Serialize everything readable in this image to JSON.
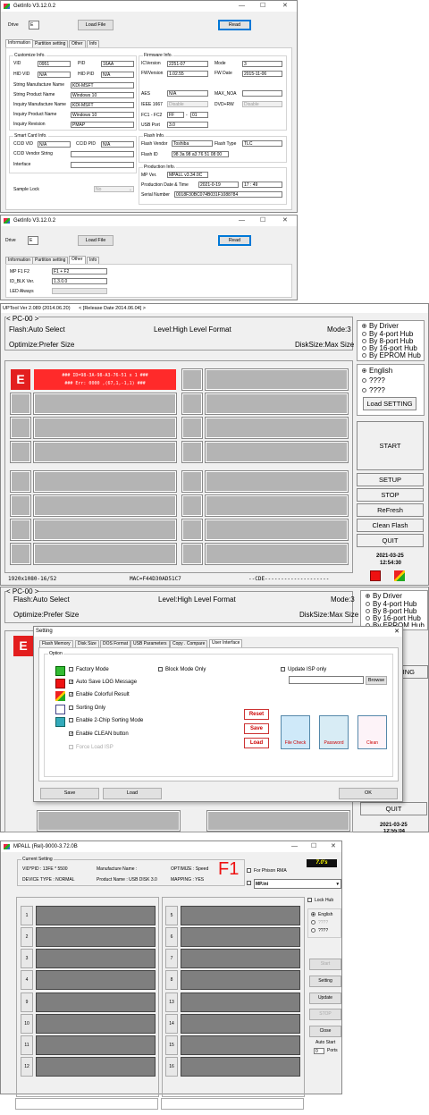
{
  "getinfo1": {
    "title": "GetInfo V3.12.0.2",
    "drive_label": "Drive",
    "drive_value": "E",
    "load_file": "Load File",
    "read": "Read",
    "tabs": [
      "Information",
      "Partition setting",
      "Other",
      "Info"
    ],
    "customize": {
      "legend": "Customize Info.",
      "vid_label": "VID",
      "vid": "0951",
      "pid_label": "PID",
      "pid": "16AA",
      "hid_vid_label": "HID VID",
      "hid_vid": "N/A",
      "hid_pid_label": "HID PID",
      "hid_pid": "N/A",
      "str_mfr_label": "String Manufacture Name",
      "str_mfr": "KDI-MSFT",
      "str_prod_label": "String Product Name",
      "str_prod": "Windows 10",
      "inq_mfr_label": "Inquiry Manufacture Name",
      "inq_mfr": "KDI-MSFT",
      "inq_prod_label": "Inquiry Product Name",
      "inq_prod": "Windows 10",
      "inq_rev_label": "Inquiry Revision",
      "inq_rev": "PMAP"
    },
    "smartcard": {
      "legend": "Smart Card Info.",
      "ccid_vid_label": "CCID VID",
      "ccid_vid": "N/A",
      "ccid_pid_label": "CCID PID",
      "ccid_pid": "N/A",
      "ccid_vendor_label": "CCID Vendor String",
      "interface_label": "Interface"
    },
    "sample_lock_label": "Sample Lock",
    "sample_lock_value": "No",
    "firmware": {
      "legend": "Firmware Info.",
      "icversion_label": "ICVersion",
      "icversion": "2251-07",
      "mode_label": "Mode",
      "mode": "3",
      "fwversion_label": "FWVersion",
      "fwversion": "1.02.55",
      "fwdate_label": "FW Date",
      "fwdate": "2015-11-06",
      "aes_label": "AES",
      "aes": "N/A",
      "maxnoa_label": "MAX_NOA",
      "ieee_label": "IEEE 1667",
      "ieee": "Disable",
      "dvdrw_label": "DVD+RW",
      "dvdrw": "Disable",
      "fc_label": "FC1 - FC2",
      "fc1": "FF",
      "fc_dash": "-",
      "fc2": "01",
      "usbport_label": "USB Port",
      "usbport": "3.0"
    },
    "flash": {
      "legend": "Flash Info.",
      "vendor_label": "Flash Vendor",
      "vendor": "Toshiba",
      "type_label": "Flash Type",
      "type": "TLC",
      "id_label": "Flash ID",
      "id": "98 3a 98 a3 76 51 08 00"
    },
    "production": {
      "legend": "Production Info.",
      "mpver_label": "MP Ver.",
      "mpver": "MPALL v3.34.0C",
      "date_label": "Production Date & Time",
      "date": "2021-0-19",
      "time": "17 : 49",
      "serial_label": "Serial Number",
      "serial": "0018F30BC074B031F1088784"
    }
  },
  "getinfo2": {
    "title": "GetInfo V3.12.0.2",
    "drive_label": "Drive",
    "drive_value": "E",
    "load_file": "Load File",
    "read": "Read",
    "tabs": [
      "Information",
      "Partition setting",
      "Other",
      "Info"
    ],
    "mp_f1f2_label": "MP F1 F2",
    "mp_f1f2": "F1 + F2",
    "id_blk_label": "ID_BLK Ver.",
    "id_blk": "1.3.0.0",
    "led_label": "LED Always"
  },
  "uptool1": {
    "title": "UPTool Ver 2.089 (2014.06.20)",
    "release": "< [Release Date 2014.06.04] >",
    "pc": "< PC-00 >",
    "flash_sel": "Flash:Auto Select",
    "level": "Level:High Level Format",
    "mode": "Mode:3",
    "optimize": "Optimize:Prefer Size",
    "disksize": "DiskSize:Max Size",
    "hub_options": [
      "By Driver",
      "By 4-port Hub",
      "By 8-port Hub",
      "By 16-port Hub",
      "By EPROM Hub"
    ],
    "lang_options": [
      "English",
      "????",
      "????"
    ],
    "load_setting": "Load SETTING",
    "start": "START",
    "setup": "SETUP",
    "stop": "STOP",
    "refresh": "ReFresh",
    "clean_flash": "Clean Flash",
    "quit": "QUIT",
    "slot_letter": "E",
    "slot_line1": "### ID=98-3A-98-A3-76-51 x 1 ###",
    "slot_line2": "### Err: 0000 ,(67,1,-1,1) ###",
    "resolution": "1920x1080-16/52",
    "mac": "MAC=F44D30AD51C7",
    "cde": "--CDE--------------------",
    "date": "2021-03-25",
    "time": "12:54:30",
    "colors": {
      "slot_red": "#e31e1e",
      "error_red": "#ff2a2a"
    }
  },
  "uptool2": {
    "pc": "< PC-00 >",
    "flash_sel": "Flash:Auto Select",
    "level": "Level:High Level Format",
    "mode": "Mode:3",
    "optimize": "Optimize:Prefer Size",
    "disksize": "DiskSize:Max Size",
    "hub_options": [
      "By Driver",
      "By 4-port Hub",
      "By 8-port Hub",
      "By 16-port Hub",
      "By EPROM Hub"
    ],
    "setting_partial": "TING",
    "quit": "QUIT",
    "date": "2021-03-25",
    "time": "12:55:04",
    "dialog": {
      "title": "Setting",
      "tabs": [
        "Flash Memory",
        "Disk Size",
        "DOS Format",
        "USB Parameters",
        "Copy . Compare",
        "User Interface"
      ],
      "option_legend": "Option",
      "factory_mode": "Factory Mode",
      "block_mode_only": "Block Mode Only",
      "update_isp_only": "Update ISP only",
      "browse": "Browse",
      "auto_save_log": "Auto Save LOG Message",
      "colorful_result": "Enable Colorful Result",
      "sorting_only": "Sorting Only",
      "two_chip": "Enable 2-Chip Sorting Mode",
      "clean_button": "Enable CLEAN button",
      "force_load_isp": "Force Load ISP",
      "icon_labels": {
        "reset": "Reset",
        "save": "Save",
        "load": "Load",
        "filecheck": "File Check",
        "password": "Password",
        "clean": "Clean"
      },
      "save": "Save",
      "load": "Load",
      "ok": "OK"
    }
  },
  "mpall": {
    "title": "MPALL (Rel)-9000-3.72.0B",
    "legend": "Current Setting",
    "vid_pid": "VID*PID : 13FE * 5500",
    "manufacturer": "Manufacture Name :",
    "optimize": "OPTIMIZE : Speed",
    "device_type": "DEVICE TYPE : NORMAL",
    "product": "Product Name : USB DISK 3.0",
    "mapping": "MAPPING : YES",
    "f1": "F1",
    "phison_rma": "For Phison RMA",
    "mp_ini": "MP.ini",
    "badge": "7.0's",
    "lock_hub": "Lock Hub",
    "lang_options": [
      "English",
      "????",
      "????"
    ],
    "start": "Start",
    "setting": "Setting",
    "update": "Update",
    "stop": "STOP",
    "close": "Close",
    "auto_start": "Auto Start",
    "auto_start_value": "0",
    "ports": "Ports",
    "left_slots": [
      "1",
      "2",
      "3",
      "4",
      "9",
      "10",
      "11",
      "12"
    ],
    "right_slots": [
      "5",
      "6",
      "7",
      "8",
      "13",
      "14",
      "15",
      "16"
    ]
  }
}
